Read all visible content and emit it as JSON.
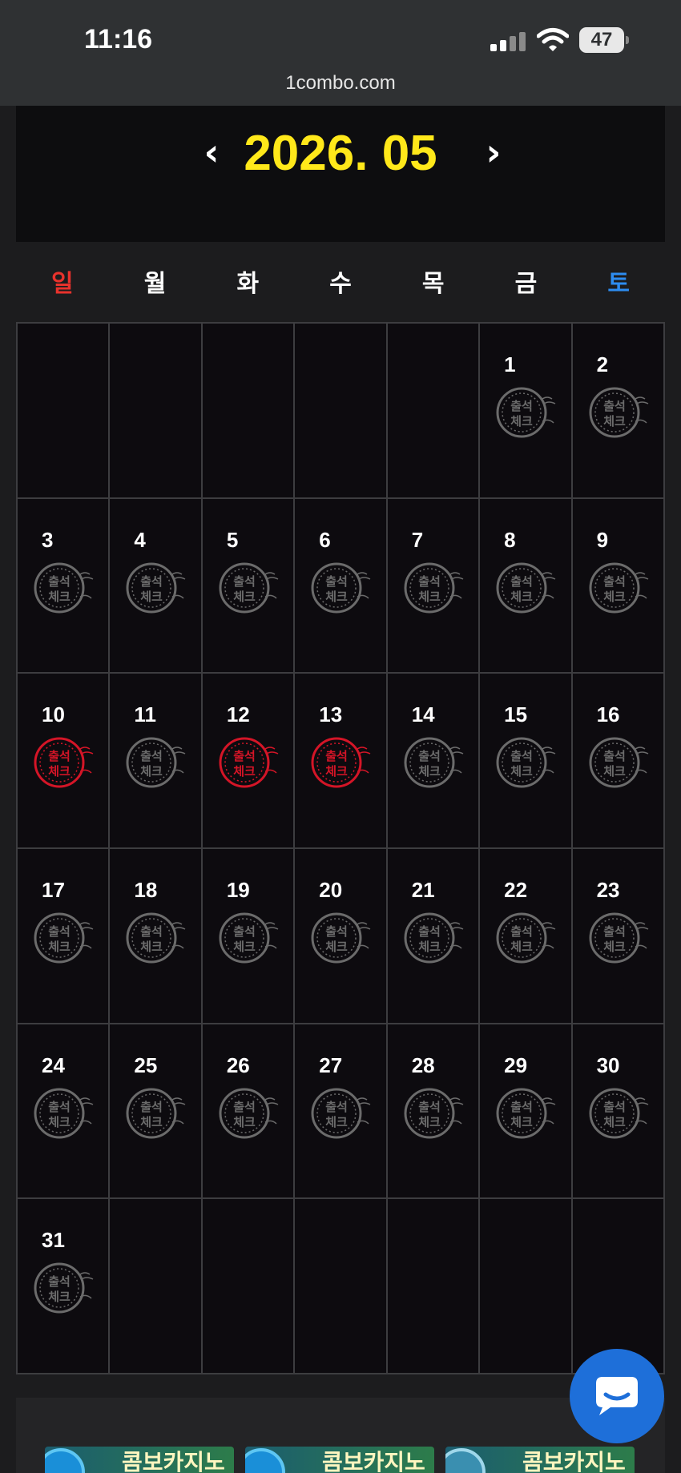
{
  "status_bar": {
    "time": "11:16",
    "battery": "47"
  },
  "browser": {
    "url": "1combo.com"
  },
  "calendar": {
    "month_label": "2026. 05",
    "weekdays": [
      "일",
      "월",
      "화",
      "수",
      "목",
      "금",
      "토"
    ],
    "weekday_colors": {
      "sunday": "#e8322c",
      "weekday": "#ffffff",
      "saturday": "#2d8cf0"
    },
    "leading_blank_days": 5,
    "days_in_month": 31,
    "stamp_text": [
      "출석",
      "체크"
    ],
    "checked_days": [
      10,
      12,
      13
    ],
    "stamp_colors": {
      "checked": "#d41527",
      "unchecked": "#6b6b6b"
    }
  },
  "banners": [
    {
      "label": "콤보카지노"
    },
    {
      "label": "콤보카지노"
    },
    {
      "label": "콤보카지노"
    }
  ],
  "colors": {
    "accent": "#ffe81a",
    "chat_button": "#1e6fd9"
  }
}
